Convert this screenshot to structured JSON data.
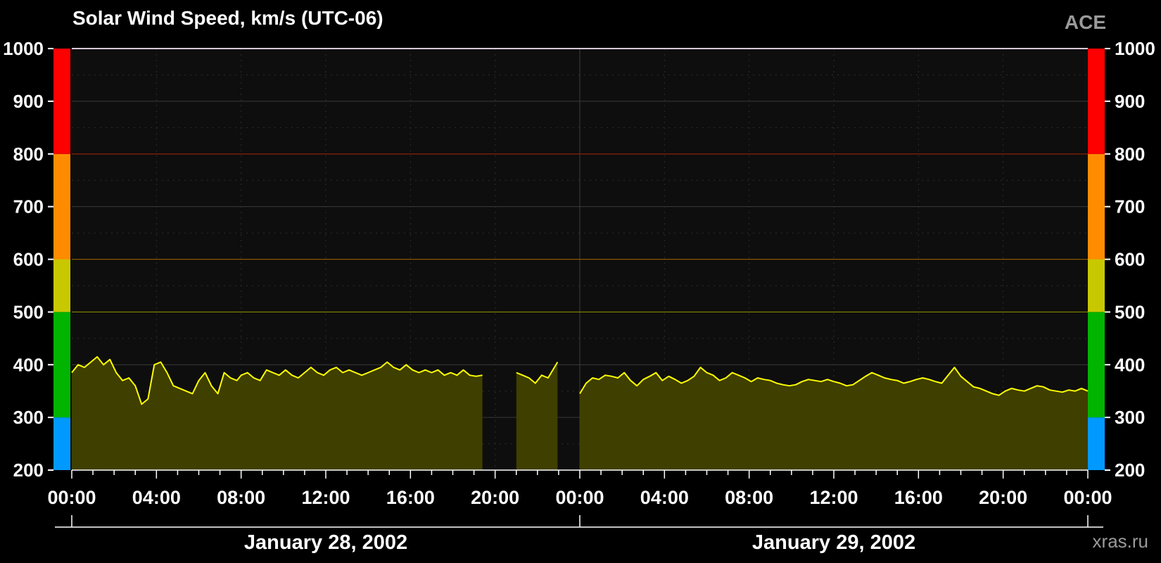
{
  "header": {
    "title": "Solar Wind Speed, km/s (UTC-06)",
    "source": "ACE",
    "credit": "xras.ru"
  },
  "chart_data": {
    "type": "area",
    "title": "Solar Wind Speed, km/s (UTC-06)",
    "ylim": [
      200,
      1000
    ],
    "y_ticks": [
      "200",
      "300",
      "400",
      "500",
      "600",
      "700",
      "800",
      "900",
      "1000"
    ],
    "x_range_hours": [
      0,
      48
    ],
    "x_ticks": [
      "00:00",
      "04:00",
      "08:00",
      "12:00",
      "16:00",
      "20:00",
      "00:00",
      "04:00",
      "08:00",
      "12:00",
      "16:00",
      "20:00",
      "00:00"
    ],
    "date_labels": [
      "January 28, 2002",
      "January 29, 2002"
    ],
    "severity_bands": [
      {
        "from": 200,
        "to": 300,
        "color": "#0099ff"
      },
      {
        "from": 300,
        "to": 500,
        "color": "#00b400"
      },
      {
        "from": 500,
        "to": 600,
        "color": "#c8c800"
      },
      {
        "from": 600,
        "to": 800,
        "color": "#ff8c00"
      },
      {
        "from": 800,
        "to": 1000,
        "color": "#ff0000"
      }
    ],
    "threshold_lines": [
      {
        "value": 500,
        "color": "#7a7a00"
      },
      {
        "value": 600,
        "color": "#8a5a00"
      },
      {
        "value": 800,
        "color": "#8a1a00"
      }
    ],
    "series": [
      {
        "line_color": "#ffff00",
        "fill_color": "#3f3f00",
        "gaps": [
          [
            19.5,
            20.9
          ],
          [
            23.0,
            23.9
          ]
        ],
        "points": [
          [
            0.0,
            385
          ],
          [
            0.3,
            400
          ],
          [
            0.6,
            395
          ],
          [
            0.9,
            405
          ],
          [
            1.2,
            415
          ],
          [
            1.5,
            400
          ],
          [
            1.8,
            410
          ],
          [
            2.1,
            385
          ],
          [
            2.4,
            370
          ],
          [
            2.7,
            375
          ],
          [
            3.0,
            360
          ],
          [
            3.3,
            325
          ],
          [
            3.6,
            335
          ],
          [
            3.9,
            400
          ],
          [
            4.2,
            405
          ],
          [
            4.5,
            385
          ],
          [
            4.8,
            360
          ],
          [
            5.1,
            355
          ],
          [
            5.4,
            350
          ],
          [
            5.7,
            345
          ],
          [
            6.0,
            370
          ],
          [
            6.3,
            385
          ],
          [
            6.6,
            360
          ],
          [
            6.9,
            345
          ],
          [
            7.2,
            385
          ],
          [
            7.5,
            375
          ],
          [
            7.8,
            370
          ],
          [
            8.0,
            380
          ],
          [
            8.3,
            385
          ],
          [
            8.6,
            375
          ],
          [
            8.9,
            370
          ],
          [
            9.2,
            390
          ],
          [
            9.5,
            385
          ],
          [
            9.8,
            380
          ],
          [
            10.1,
            390
          ],
          [
            10.4,
            380
          ],
          [
            10.7,
            375
          ],
          [
            11.0,
            385
          ],
          [
            11.3,
            395
          ],
          [
            11.6,
            385
          ],
          [
            11.9,
            380
          ],
          [
            12.2,
            390
          ],
          [
            12.5,
            395
          ],
          [
            12.8,
            385
          ],
          [
            13.1,
            390
          ],
          [
            13.4,
            385
          ],
          [
            13.7,
            380
          ],
          [
            14.0,
            385
          ],
          [
            14.3,
            390
          ],
          [
            14.6,
            395
          ],
          [
            14.9,
            405
          ],
          [
            15.2,
            395
          ],
          [
            15.5,
            390
          ],
          [
            15.8,
            400
          ],
          [
            16.1,
            390
          ],
          [
            16.4,
            385
          ],
          [
            16.7,
            390
          ],
          [
            17.0,
            385
          ],
          [
            17.3,
            390
          ],
          [
            17.6,
            380
          ],
          [
            17.9,
            385
          ],
          [
            18.2,
            380
          ],
          [
            18.5,
            390
          ],
          [
            18.8,
            380
          ],
          [
            19.1,
            378
          ],
          [
            19.4,
            380
          ],
          [
            21.0,
            385
          ],
          [
            21.3,
            380
          ],
          [
            21.6,
            375
          ],
          [
            21.9,
            365
          ],
          [
            22.2,
            380
          ],
          [
            22.5,
            375
          ],
          [
            22.8,
            395
          ],
          [
            22.95,
            405
          ],
          [
            24.0,
            345
          ],
          [
            24.3,
            365
          ],
          [
            24.6,
            375
          ],
          [
            24.9,
            372
          ],
          [
            25.2,
            380
          ],
          [
            25.5,
            378
          ],
          [
            25.8,
            375
          ],
          [
            26.1,
            385
          ],
          [
            26.4,
            370
          ],
          [
            26.7,
            360
          ],
          [
            27.0,
            372
          ],
          [
            27.3,
            378
          ],
          [
            27.6,
            385
          ],
          [
            27.9,
            370
          ],
          [
            28.2,
            378
          ],
          [
            28.5,
            372
          ],
          [
            28.8,
            365
          ],
          [
            29.1,
            370
          ],
          [
            29.4,
            378
          ],
          [
            29.7,
            395
          ],
          [
            30.0,
            385
          ],
          [
            30.3,
            380
          ],
          [
            30.6,
            370
          ],
          [
            30.9,
            375
          ],
          [
            31.2,
            385
          ],
          [
            31.5,
            380
          ],
          [
            31.8,
            375
          ],
          [
            32.1,
            368
          ],
          [
            32.4,
            375
          ],
          [
            32.7,
            372
          ],
          [
            33.0,
            370
          ],
          [
            33.3,
            365
          ],
          [
            33.6,
            362
          ],
          [
            33.9,
            360
          ],
          [
            34.2,
            362
          ],
          [
            34.5,
            368
          ],
          [
            34.8,
            372
          ],
          [
            35.1,
            370
          ],
          [
            35.4,
            368
          ],
          [
            35.7,
            372
          ],
          [
            36.0,
            368
          ],
          [
            36.3,
            365
          ],
          [
            36.6,
            360
          ],
          [
            36.9,
            362
          ],
          [
            37.2,
            370
          ],
          [
            37.5,
            378
          ],
          [
            37.8,
            385
          ],
          [
            38.1,
            380
          ],
          [
            38.4,
            375
          ],
          [
            38.7,
            372
          ],
          [
            39.0,
            370
          ],
          [
            39.3,
            365
          ],
          [
            39.6,
            368
          ],
          [
            39.9,
            372
          ],
          [
            40.2,
            375
          ],
          [
            40.5,
            372
          ],
          [
            40.8,
            368
          ],
          [
            41.1,
            365
          ],
          [
            41.4,
            380
          ],
          [
            41.7,
            395
          ],
          [
            42.0,
            378
          ],
          [
            42.3,
            368
          ],
          [
            42.6,
            358
          ],
          [
            42.9,
            355
          ],
          [
            43.2,
            350
          ],
          [
            43.5,
            345
          ],
          [
            43.8,
            342
          ],
          [
            44.1,
            350
          ],
          [
            44.4,
            355
          ],
          [
            44.7,
            352
          ],
          [
            45.0,
            350
          ],
          [
            45.3,
            355
          ],
          [
            45.6,
            360
          ],
          [
            45.9,
            358
          ],
          [
            46.2,
            352
          ],
          [
            46.5,
            350
          ],
          [
            46.8,
            348
          ],
          [
            47.1,
            352
          ],
          [
            47.4,
            350
          ],
          [
            47.7,
            355
          ],
          [
            48.0,
            350
          ]
        ]
      }
    ]
  }
}
